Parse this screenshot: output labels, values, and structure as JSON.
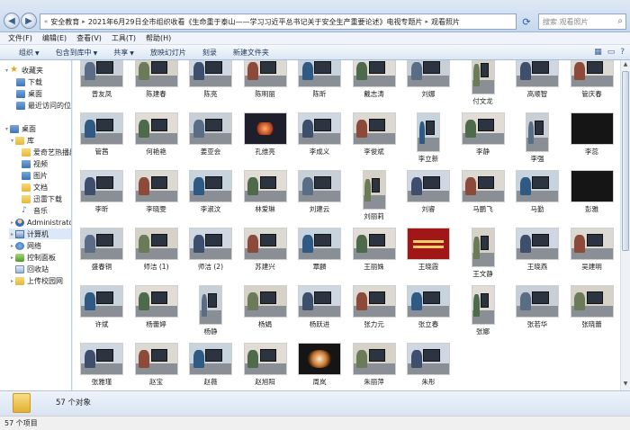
{
  "breadcrumb": [
    "安全教育",
    "2021年6月29日全市组织收看《生命重于泰山——学习习近平总书记关于安全生产重要论述》电视专题片",
    "观看照片"
  ],
  "search_placeholder": "搜索 观看照片",
  "menu": [
    "文件(F)",
    "编辑(E)",
    "查看(V)",
    "工具(T)",
    "帮助(H)"
  ],
  "toolbar": [
    "组织",
    "包含到库中",
    "共享",
    "放映幻灯片",
    "刻录",
    "新建文件夹"
  ],
  "nav": {
    "favorites": "收藏夹",
    "fav_items": [
      "下载",
      "桌面",
      "最近访问的位置"
    ],
    "desktop": "桌面",
    "library": "库",
    "lib_items": [
      "爱奇艺热播剧",
      "视频",
      "图片",
      "文档",
      "迅雷下载",
      "音乐"
    ],
    "admin": "Administrator",
    "computer": "计算机",
    "network": "网络",
    "control_panel": "控制面板",
    "recycle": "回收站",
    "campus": "上传校园网"
  },
  "files": [
    "曾友凤",
    "陈建春",
    "陈亮",
    "陈明丽",
    "陈昕",
    "戴志涛",
    "刘娜",
    "付文龙",
    "高顺智",
    "管庆春",
    "管茜",
    "何艳艳",
    "姜亚会",
    "孔维亮",
    "李成义",
    "李俊斌",
    "李立新",
    "李静",
    "李强",
    "李蕊",
    "李昕",
    "李晓雯",
    "李淑汶",
    "林爱琳",
    "刘建云",
    "刘丽莉",
    "刘睿",
    "马鹏飞",
    "马勤",
    "彭雅",
    "盛春铜",
    "师洁 (1)",
    "师洁 (2)",
    "苏建兴",
    "覃麟",
    "王丽姝",
    "王晓霞",
    "王文静",
    "王晓燕",
    "吴建明",
    "许斌",
    "杨蕾婷",
    "杨静",
    "杨娟",
    "杨跃进",
    "张力元",
    "张立春",
    "张娜",
    "张若华",
    "张晓蕾",
    "张雅瑾",
    "赵宝",
    "赵薇",
    "赵旭阳",
    "周岚",
    "朱丽萍",
    "朱彤"
  ],
  "item_count_detail": "57 个对象",
  "status": "57 个项目"
}
